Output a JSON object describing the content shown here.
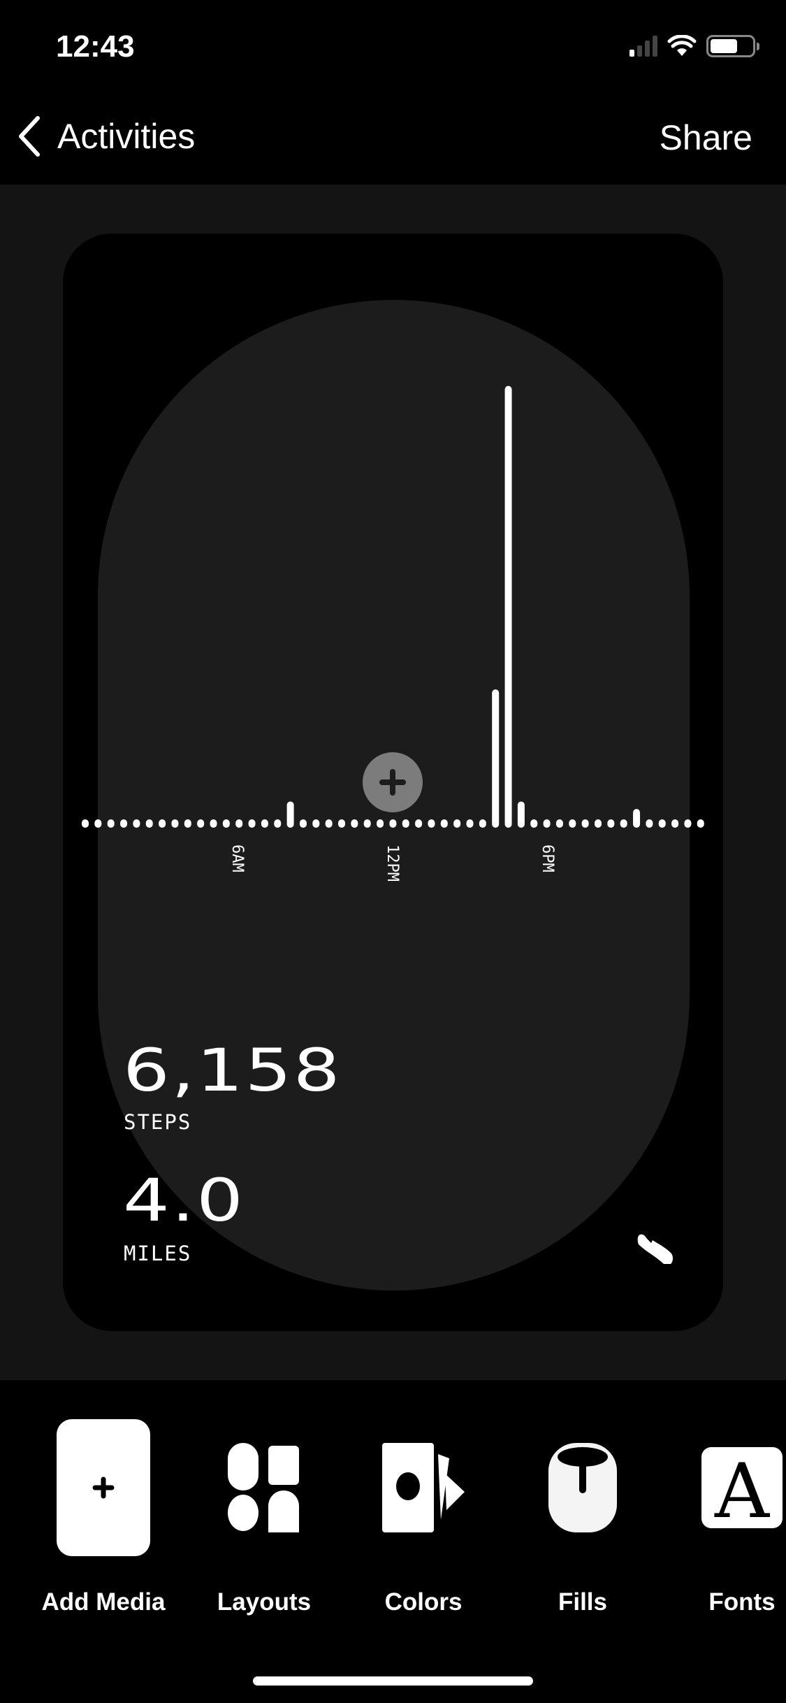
{
  "status_bar": {
    "time": "12:43",
    "signal_bars": 1,
    "battery_level": 0.65
  },
  "nav": {
    "back_label": "Activities",
    "share_label": "Share"
  },
  "card": {
    "steps_value": "6,158",
    "steps_label": "STEPS",
    "distance_value": "4.0",
    "distance_label": "MILES",
    "activity_icon": "sneaker-icon",
    "add_icon": "plus-icon"
  },
  "chart_data": {
    "type": "bar",
    "x_unit": "30-minute intervals from 12AM",
    "tick_labels": [
      "6AM",
      "12PM",
      "6PM"
    ],
    "tick_indices": [
      12,
      24,
      36
    ],
    "values": [
      0,
      0,
      0,
      0,
      0,
      0,
      0,
      0,
      0,
      0,
      0,
      0,
      0,
      0,
      0,
      0,
      180,
      0,
      0,
      0,
      0,
      0,
      0,
      0,
      0,
      0,
      0,
      0,
      0,
      0,
      0,
      0,
      1310,
      4370,
      180,
      0,
      0,
      0,
      0,
      0,
      0,
      0,
      0,
      105,
      0,
      0,
      0,
      0,
      0
    ],
    "total": 6158,
    "color": "#ffffff"
  },
  "toolbar": {
    "items": [
      {
        "label": "Add Media",
        "icon": "add-media-icon"
      },
      {
        "label": "Layouts",
        "icon": "layouts-icon"
      },
      {
        "label": "Colors",
        "icon": "colors-icon"
      },
      {
        "label": "Fills",
        "icon": "fills-icon"
      },
      {
        "label": "Fonts",
        "icon": "fonts-icon"
      }
    ]
  },
  "colors": {
    "background": "#000000",
    "canvas": "#141414",
    "capsule": "#1c1c1c",
    "add_button": "#7c7c7c"
  }
}
